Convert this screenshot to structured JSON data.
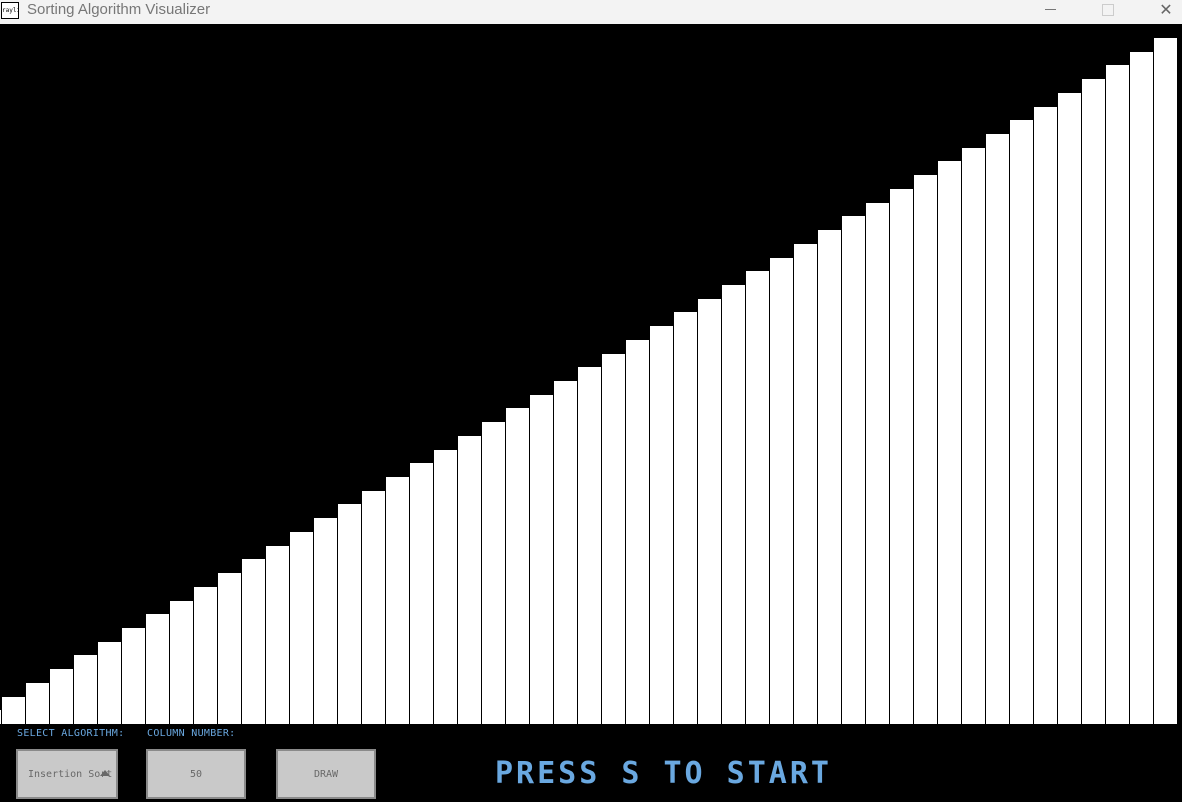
{
  "window": {
    "title": "Sorting Algorithm Visualizer",
    "icon_label": "raylib",
    "close_glyph": "✕"
  },
  "chart_data": {
    "type": "bar",
    "count": 50,
    "values": [
      1,
      2,
      3,
      4,
      5,
      6,
      7,
      8,
      9,
      10,
      11,
      12,
      13,
      14,
      15,
      16,
      17,
      18,
      19,
      20,
      21,
      22,
      23,
      24,
      25,
      26,
      27,
      28,
      29,
      30,
      31,
      32,
      33,
      34,
      35,
      36,
      37,
      38,
      39,
      40,
      41,
      42,
      43,
      44,
      45,
      46,
      47,
      48,
      49,
      50
    ],
    "max_value": 50,
    "bar_color": "#ffffff",
    "background": "#000000"
  },
  "controls": {
    "algorithm_label": "SELECT ALGORITHM:",
    "column_label": "COLUMN NUMBER:",
    "algorithm_value": "Insertion Sort",
    "column_value": "50",
    "draw_label": "DRAW"
  },
  "status": {
    "start_message": "PRESS S TO START"
  },
  "colors": {
    "accent": "#6aa8e0",
    "button_bg": "#c9c9c9"
  }
}
